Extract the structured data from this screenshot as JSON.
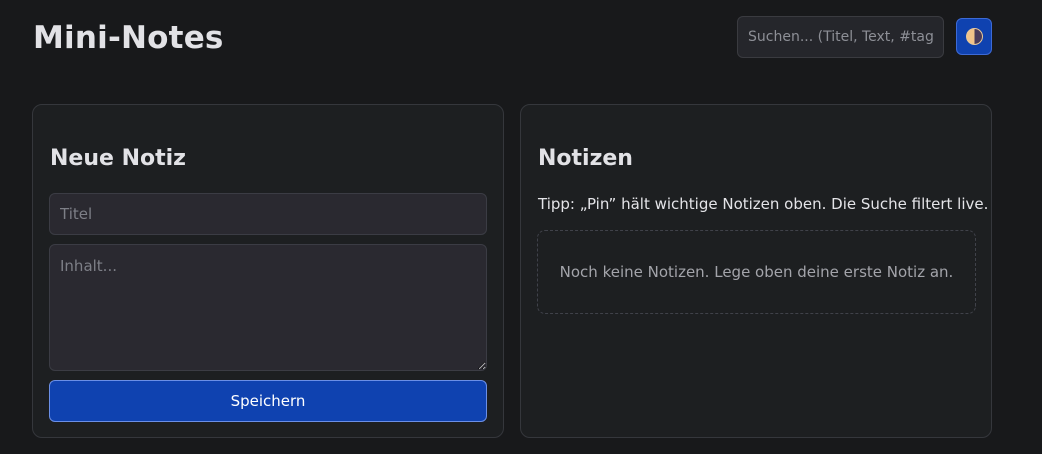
{
  "app": {
    "title": "Mini-Notes"
  },
  "search": {
    "placeholder": "Suchen... (Titel, Text, #tag)",
    "value": ""
  },
  "theme_toggle": {
    "icon": "half-moon-icon"
  },
  "new_note": {
    "heading": "Neue Notiz",
    "title_placeholder": "Titel",
    "content_placeholder": "Inhalt...",
    "save_label": "Speichern"
  },
  "notes": {
    "heading": "Notizen",
    "tip": "Tipp: „Pin” hält wichtige Notizen oben. Die Suche filtert live.",
    "empty_message": "Noch keine Notizen. Lege oben deine erste Notiz an."
  },
  "colors": {
    "background": "#18191b",
    "panel": "#1d1f21",
    "accent": "#0f42b0"
  }
}
